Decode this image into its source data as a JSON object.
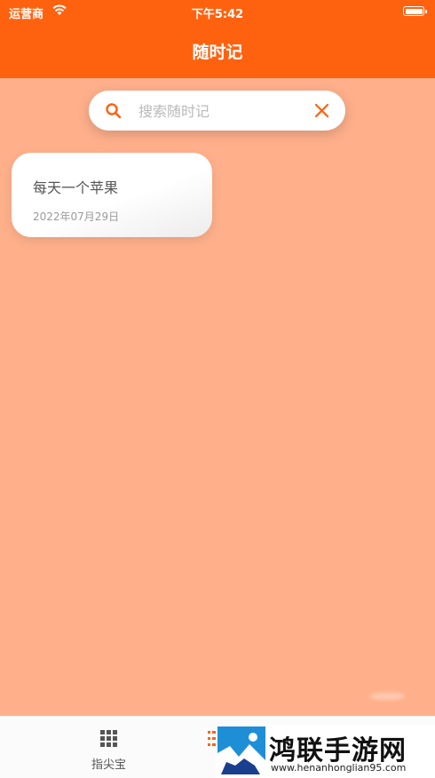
{
  "status_bar": {
    "carrier": "运营商",
    "time": "下午5:42"
  },
  "header": {
    "title": "随时记"
  },
  "search": {
    "placeholder": "搜索随时记",
    "value": ""
  },
  "notes": [
    {
      "title": "每天一个苹果",
      "date": "2022年07月29日"
    }
  ],
  "tabbar": {
    "tabs": [
      {
        "label": "指尖宝",
        "icon": "grid-icon"
      },
      {
        "label": "记",
        "icon": "list-icon",
        "active": true
      }
    ]
  },
  "watermark": {
    "name": "鸿联手游网",
    "url": "www.henanhonglian95.com"
  },
  "colors": {
    "primary": "#ff620f",
    "background": "#ffb08b"
  }
}
